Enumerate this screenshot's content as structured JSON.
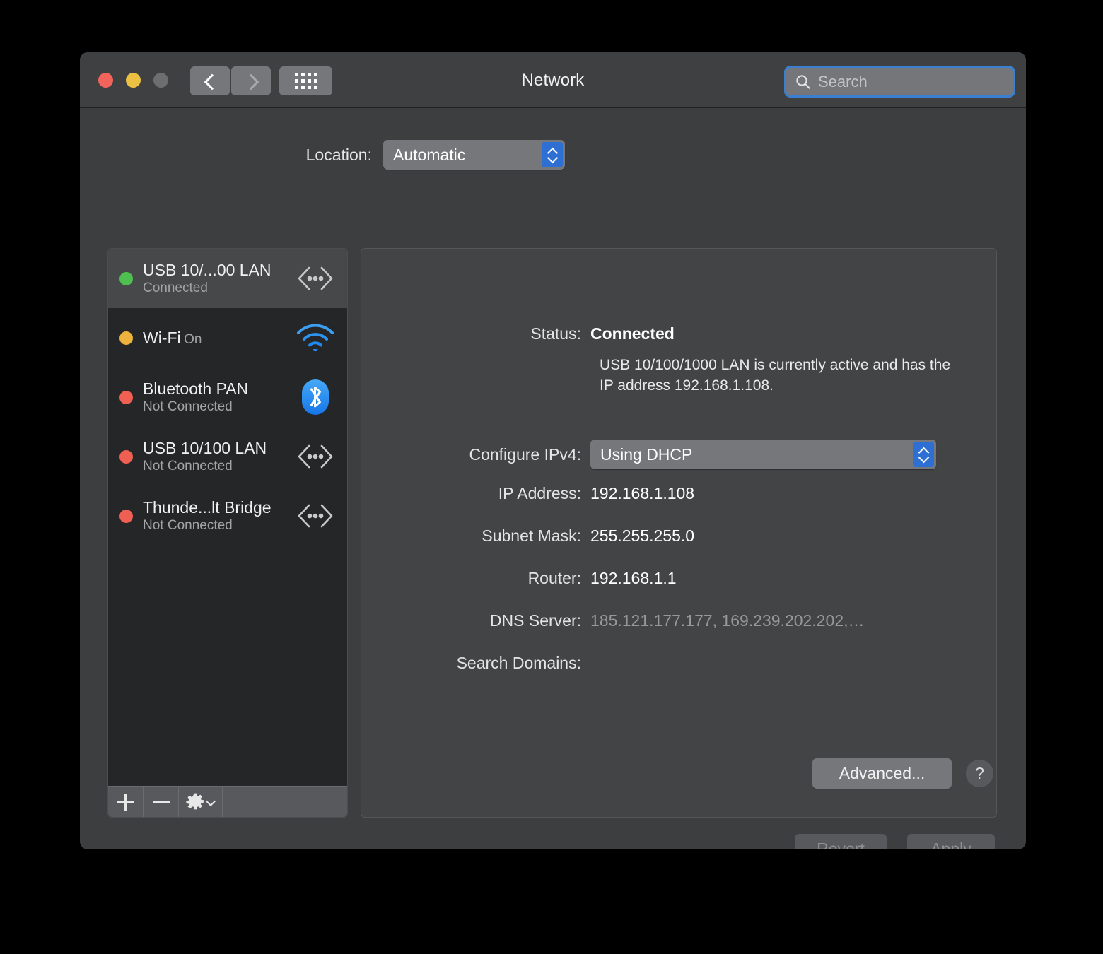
{
  "window": {
    "title": "Network",
    "traffic_lights": [
      "close",
      "minimize",
      "zoom"
    ]
  },
  "toolbar": {
    "back_icon": "chevron-left-icon",
    "forward_icon": "chevron-right-icon",
    "grid_icon": "show-all-grid-icon",
    "search": {
      "placeholder": "Search",
      "value": "",
      "icon": "search-icon"
    }
  },
  "location": {
    "label": "Location:",
    "value": "Automatic",
    "options": [
      "Automatic"
    ]
  },
  "sidebar": {
    "services": [
      {
        "name": "USB 10/...00 LAN",
        "status": "Connected",
        "dot": "green",
        "icon": "ethernet-port-icon",
        "selected": true
      },
      {
        "name": "Wi-Fi",
        "status": "On",
        "dot": "amber",
        "icon": "wifi-icon",
        "selected": false
      },
      {
        "name": "Bluetooth PAN",
        "status": "Not Connected",
        "dot": "red",
        "icon": "bluetooth-icon",
        "selected": false
      },
      {
        "name": "USB 10/100 LAN",
        "status": "Not Connected",
        "dot": "red",
        "icon": "ethernet-port-icon",
        "selected": false
      },
      {
        "name": "Thunde...lt Bridge",
        "status": "Not Connected",
        "dot": "red",
        "icon": "ethernet-port-icon",
        "selected": false
      }
    ],
    "toolbar": {
      "add_icon": "plus-icon",
      "remove_icon": "minus-icon",
      "action_icon": "gear-icon"
    }
  },
  "details": {
    "status_label": "Status:",
    "status_value": "Connected",
    "status_description": "USB 10/100/1000 LAN is currently active and has the IP address 192.168.1.108.",
    "configure_ipv4_label": "Configure IPv4:",
    "configure_ipv4_value": "Using DHCP",
    "configure_ipv4_options": [
      "Using DHCP"
    ],
    "ip_address_label": "IP Address:",
    "ip_address_value": "192.168.1.108",
    "subnet_mask_label": "Subnet Mask:",
    "subnet_mask_value": "255.255.255.0",
    "router_label": "Router:",
    "router_value": "192.168.1.1",
    "dns_server_label": "DNS Server:",
    "dns_server_value": "185.121.177.177, 169.239.202.202,…",
    "search_domains_label": "Search Domains:",
    "search_domains_value": "",
    "advanced_label": "Advanced...",
    "help_label": "?"
  },
  "footer": {
    "revert_label": "Revert",
    "apply_label": "Apply"
  },
  "colors": {
    "accent_blue": "#2e6fd4",
    "focus_ring": "#3c7fd0",
    "status_green": "#4fc04f",
    "status_amber": "#eeb33c",
    "status_red": "#ef6052"
  }
}
